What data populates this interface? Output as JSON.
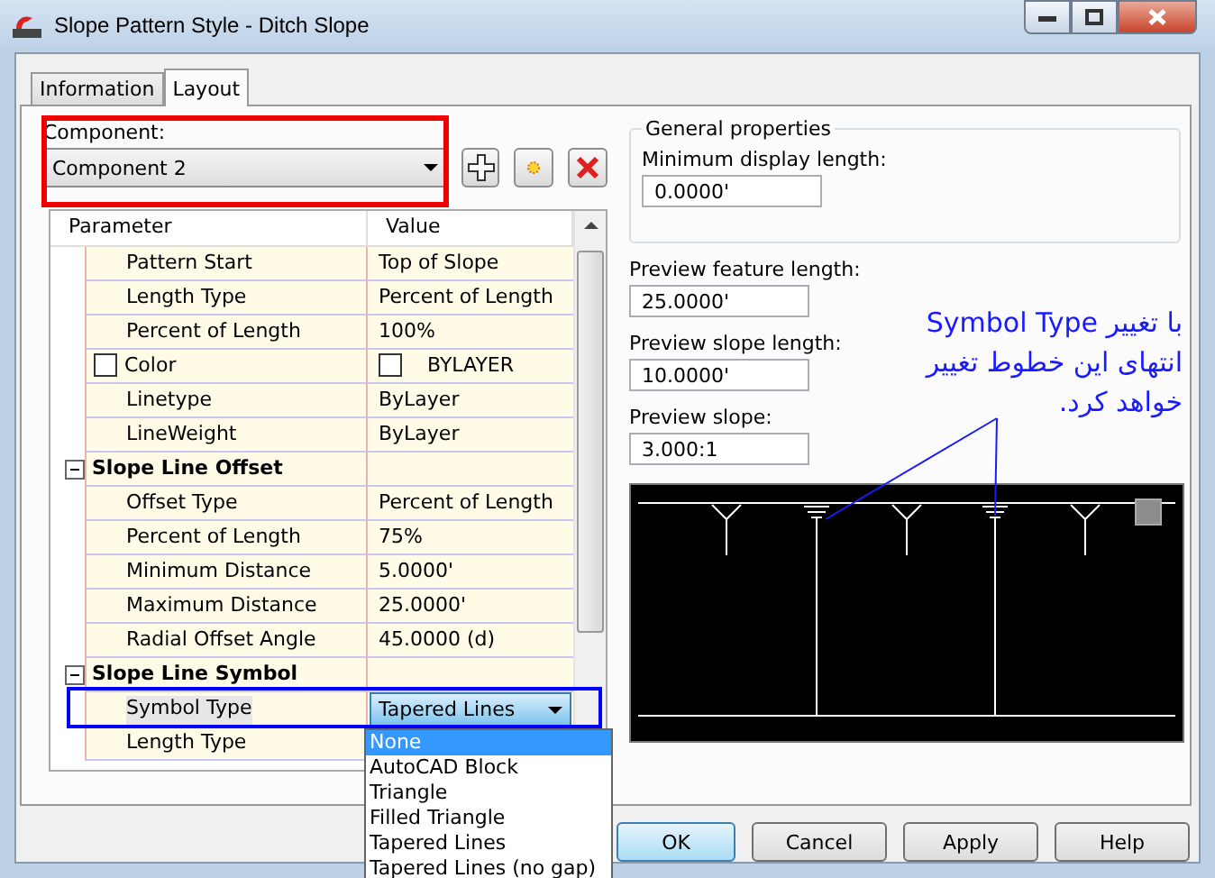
{
  "window": {
    "title": "Slope Pattern Style - Ditch Slope"
  },
  "tabs": [
    {
      "label": "Information",
      "selected": false
    },
    {
      "label": "Layout",
      "selected": true
    }
  ],
  "component": {
    "label": "Component:",
    "value": "Component 2"
  },
  "grid": {
    "columns": [
      "Parameter",
      "Value"
    ],
    "rows": [
      {
        "kind": "property",
        "name": "Pattern Start",
        "value": "Top of Slope",
        "selected": false
      },
      {
        "kind": "property",
        "name": "Length Type",
        "value": "Percent of Length",
        "selected": false
      },
      {
        "kind": "property",
        "name": "Percent of Length",
        "value": "100%",
        "selected": false
      },
      {
        "kind": "color",
        "name": "Color",
        "value": "BYLAYER",
        "selected": false
      },
      {
        "kind": "property",
        "name": "Linetype",
        "value": "ByLayer",
        "selected": false
      },
      {
        "kind": "property",
        "name": "LineWeight",
        "value": "ByLayer",
        "selected": false
      },
      {
        "kind": "group",
        "name": "Slope Line Offset",
        "expanded": true
      },
      {
        "kind": "property",
        "name": "Offset Type",
        "value": "Percent of Length",
        "selected": false
      },
      {
        "kind": "property",
        "name": "Percent of Length",
        "value": "75%",
        "selected": false
      },
      {
        "kind": "property",
        "name": "Minimum Distance",
        "value": "5.0000'",
        "selected": false
      },
      {
        "kind": "property",
        "name": "Maximum Distance",
        "value": "25.0000'",
        "selected": false
      },
      {
        "kind": "property",
        "name": "Radial Offset Angle",
        "value": "45.0000 (d)",
        "selected": false
      },
      {
        "kind": "group",
        "name": "Slope Line Symbol",
        "expanded": true
      },
      {
        "kind": "dropdown",
        "name": "Symbol Type",
        "value": "Tapered Lines",
        "selected": true
      },
      {
        "kind": "property",
        "name": "Length Type",
        "value": "",
        "selected": false
      }
    ]
  },
  "dropdown_options": [
    {
      "label": "None",
      "selected": true
    },
    {
      "label": "AutoCAD Block",
      "selected": false
    },
    {
      "label": "Triangle",
      "selected": false
    },
    {
      "label": "Filled Triangle",
      "selected": false
    },
    {
      "label": "Tapered Lines",
      "selected": false
    },
    {
      "label": "Tapered Lines (no gap)",
      "selected": false
    }
  ],
  "general_properties": {
    "title": "General properties",
    "fields": [
      {
        "label": "Minimum display length:",
        "value": "0.0000'"
      }
    ]
  },
  "preview_fields": [
    {
      "label": "Preview feature length:",
      "value": "25.0000'"
    },
    {
      "label": "Preview slope length:",
      "value": "10.0000'"
    },
    {
      "label": "Preview slope:",
      "value": "3.000:1"
    }
  ],
  "annotation": "با تغییر Symbol Type انتهای این خطوط تغییر خواهد کرد.",
  "buttons": [
    {
      "label": "OK",
      "default": true
    },
    {
      "label": "Cancel",
      "default": false
    },
    {
      "label": "Apply",
      "default": false
    },
    {
      "label": "Help",
      "default": false
    }
  ]
}
